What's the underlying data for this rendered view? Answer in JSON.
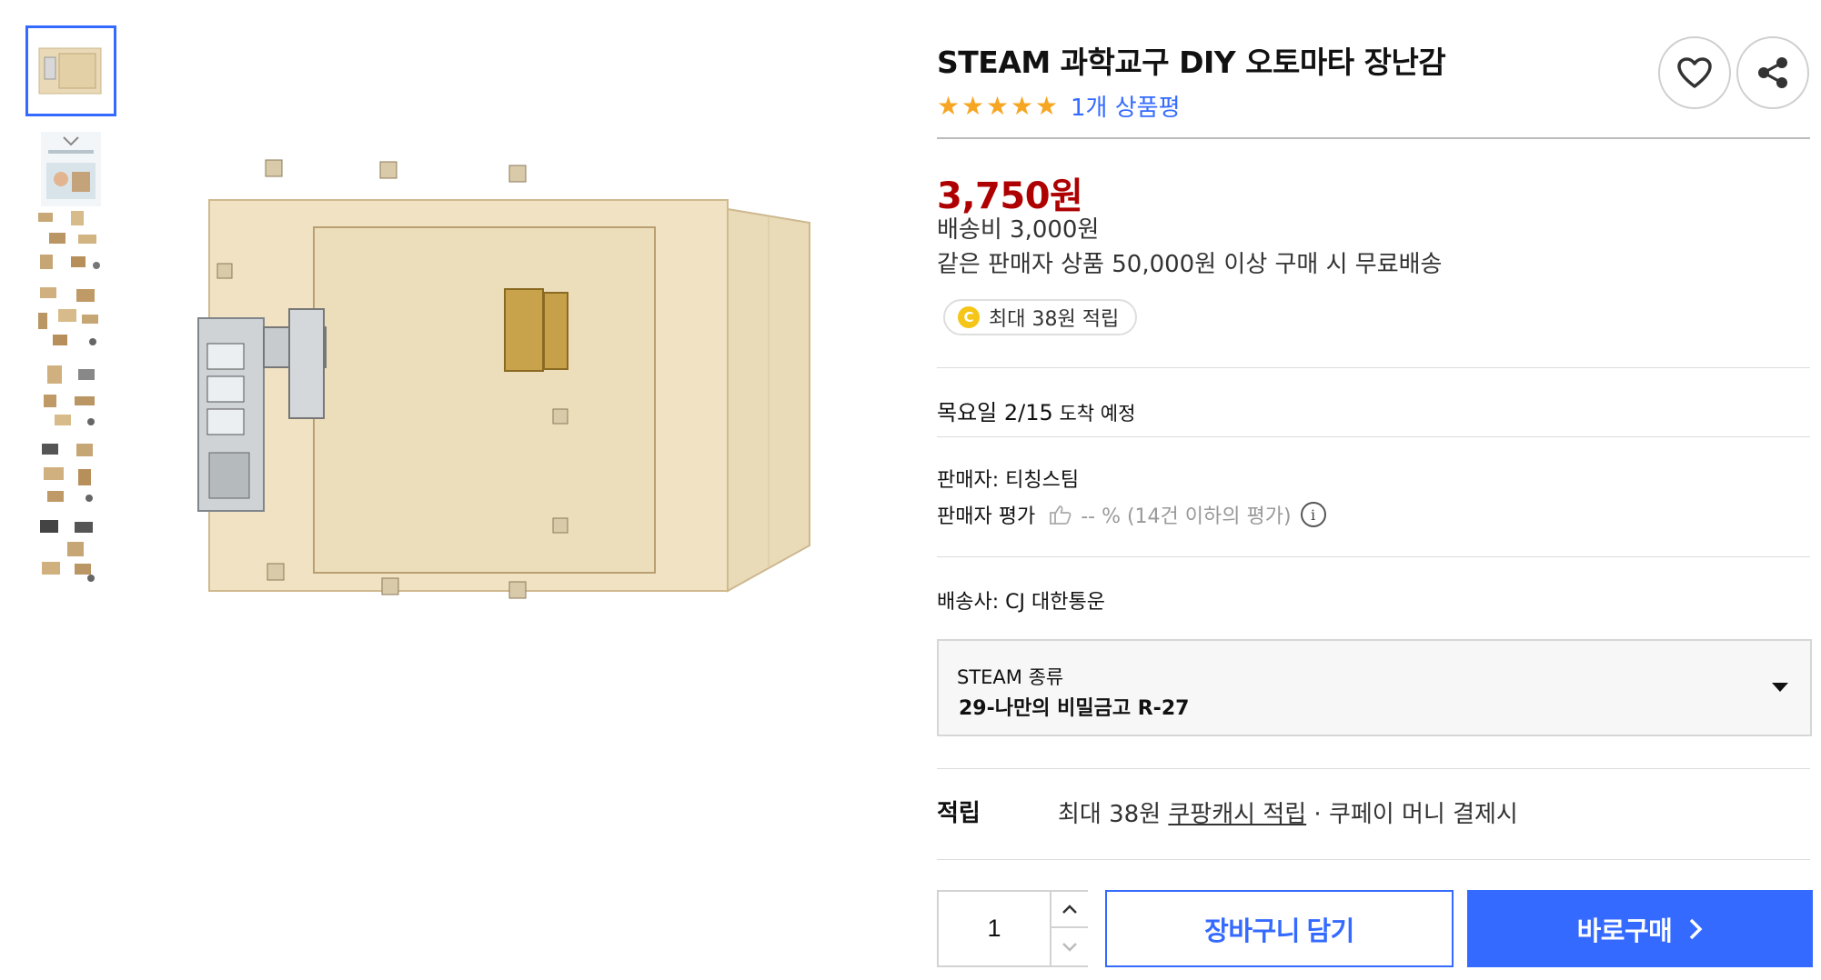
{
  "product": {
    "title": "STEAM 과학교구 DIY 오토마타 장난감",
    "rating_stars": 5,
    "review_link": "1개 상품평"
  },
  "price": {
    "amount": "3,750원",
    "shipping_fee": "배송비 3,000원",
    "free_shipping_note": "같은 판매자 상품 50,000원 이상 구매 시 무료배송",
    "cash_badge_coin": "C",
    "cash_badge": "최대 38원 적립"
  },
  "delivery": {
    "arrival_main": "목요일 2/15",
    "arrival_suffix": " 도착 예정"
  },
  "seller": {
    "name_line": "판매자: 티칭스팀",
    "rating_label": "판매자 평가",
    "rating_value": "-- % (14건 이하의 평가)",
    "info_icon": "i"
  },
  "carrier": {
    "line": "배송사: CJ 대한통운"
  },
  "option": {
    "label": "STEAM 종류",
    "selected": "29-나만의 비밀금고 R-27"
  },
  "reward": {
    "title": "적립",
    "text_prefix": "최대 38원 ",
    "link_text": "쿠팡캐시 적립",
    "text_suffix": " · 쿠페이 머니 결제시"
  },
  "purchase": {
    "quantity": "1",
    "cart_button": "장바구니 담기",
    "buy_button": "바로구매"
  },
  "icons": {
    "wishlist": "heart-icon",
    "share": "share-icon",
    "qty_up": "chevron-up-icon",
    "qty_down": "chevron-down-icon",
    "buy_arrow": "chevron-right-icon",
    "dropdown": "caret-down-icon",
    "thumb_up": "thumbs-up-icon"
  },
  "colors": {
    "accent": "#346aff",
    "price": "#ae0000",
    "star": "#f6a623"
  }
}
